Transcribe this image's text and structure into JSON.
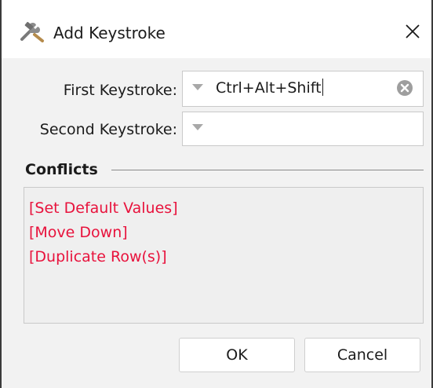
{
  "window": {
    "title": "Add Keystroke",
    "title_icon": "tools-icon",
    "close_icon": "close-icon"
  },
  "form": {
    "first_keystroke_label": "First Keystroke:",
    "first_keystroke_value": "Ctrl+Alt+Shift",
    "second_keystroke_label": "Second Keystroke:",
    "second_keystroke_value": ""
  },
  "conflicts": {
    "title": "Conflicts",
    "items": [
      "[Set Default Values]",
      "[Move Down]",
      "[Duplicate Row(s)]"
    ],
    "item_color": "#e8123c"
  },
  "buttons": {
    "ok_label": "OK",
    "cancel_label": "Cancel"
  }
}
